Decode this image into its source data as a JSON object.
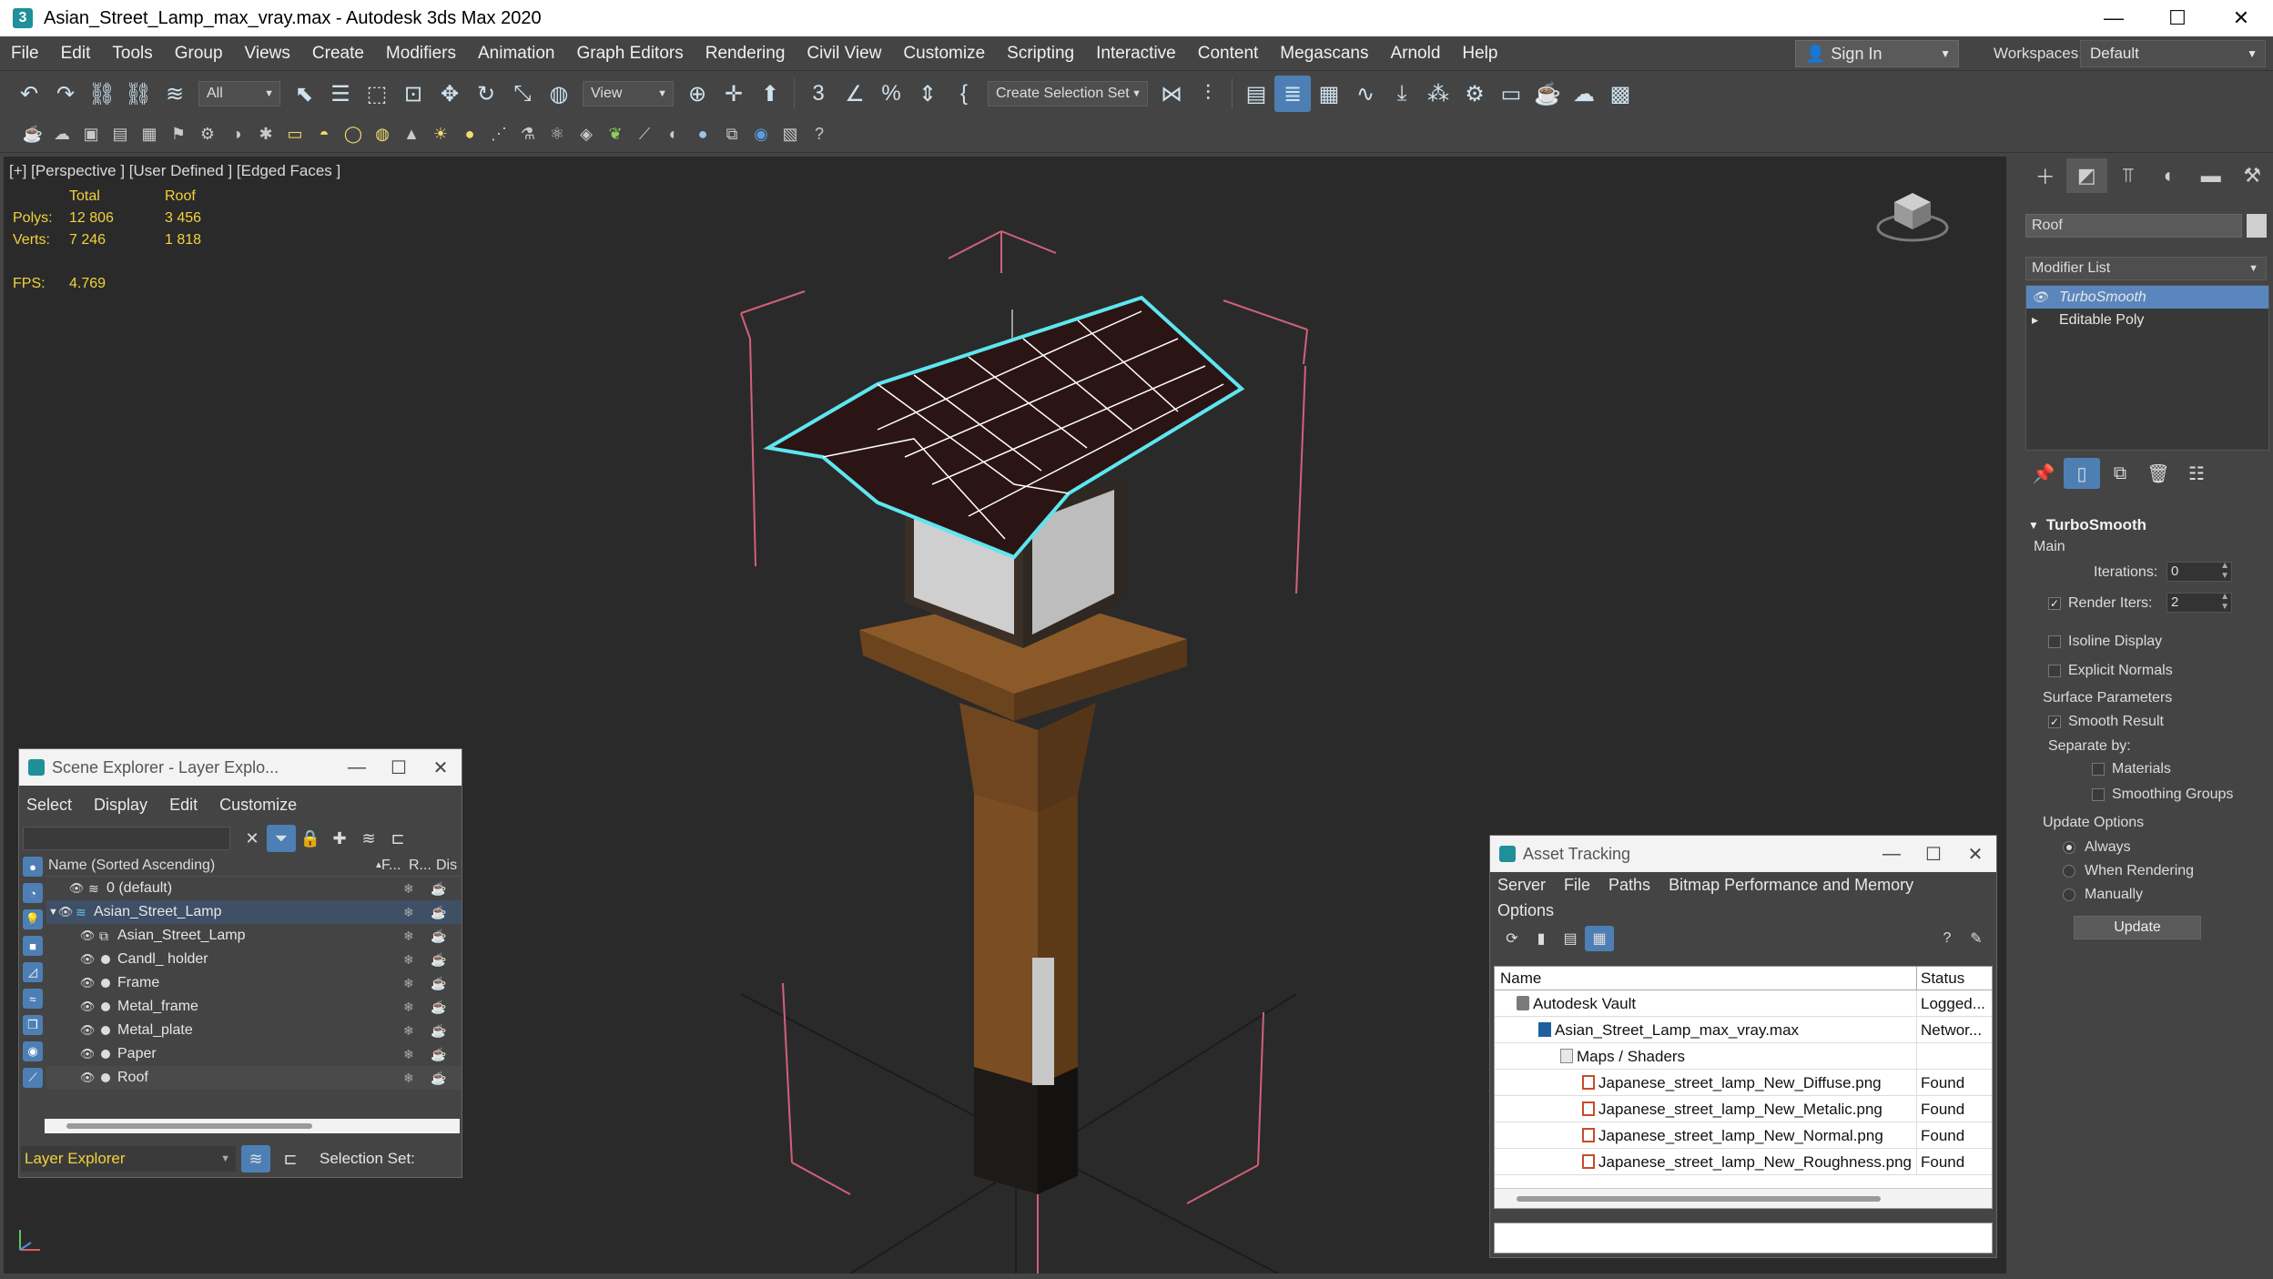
{
  "window": {
    "title": "Asian_Street_Lamp_max_vray.max - Autodesk 3ds Max 2020",
    "app_icon": "3",
    "minimize_icon": "—",
    "maximize_icon": "☐",
    "close_icon": "✕"
  },
  "menubar": {
    "items": [
      "File",
      "Edit",
      "Tools",
      "Group",
      "Views",
      "Create",
      "Modifiers",
      "Animation",
      "Graph Editors",
      "Rendering",
      "Civil View",
      "Customize",
      "Scripting",
      "Interactive",
      "Content",
      "Megascans",
      "Arnold",
      "Help"
    ],
    "signin_label": "Sign In",
    "workspaces_label": "Workspaces:",
    "workspace_value": "Default"
  },
  "toolbar": {
    "selection_filter": "All",
    "reference_coord": "View",
    "named_selection": "Create Selection Set"
  },
  "viewport": {
    "label": "[+] [Perspective ] [User Defined ] [Edged Faces ]",
    "stats": {
      "header": [
        "",
        "Total",
        "Roof"
      ],
      "polys": [
        "Polys:",
        "12 806",
        "3 456"
      ],
      "verts": [
        "Verts:",
        "7 246",
        "1 818"
      ],
      "fps": [
        "FPS:",
        "4.769"
      ]
    }
  },
  "command_panel": {
    "object_name": "Roof",
    "modifier_list_label": "Modifier List",
    "stack": [
      "TurboSmooth",
      "Editable Poly"
    ],
    "rollout": {
      "title": "TurboSmooth",
      "main_label": "Main",
      "iterations_label": "Iterations:",
      "iterations_value": "0",
      "render_iters_label": "Render Iters:",
      "render_iters_value": "2",
      "render_iters_checked": "✓",
      "isoline_label": "Isoline Display",
      "explicit_normals_label": "Explicit Normals",
      "surface_params_label": "Surface Parameters",
      "smooth_result_label": "Smooth Result",
      "smooth_result_checked": "✓",
      "separate_by_label": "Separate by:",
      "materials_label": "Materials",
      "smoothing_groups_label": "Smoothing Groups",
      "update_options_label": "Update Options",
      "always_label": "Always",
      "when_rendering_label": "When Rendering",
      "manually_label": "Manually",
      "update_button": "Update"
    }
  },
  "scene_explorer": {
    "title": "Scene Explorer - Layer Explo...",
    "menu": [
      "Select",
      "Display",
      "Edit",
      "Customize"
    ],
    "columns": [
      "Name (Sorted Ascending)",
      "F...",
      "R...",
      "Dis"
    ],
    "rows": [
      {
        "name": "0 (default)"
      },
      {
        "name": "Asian_Street_Lamp"
      },
      {
        "name": "Asian_Street_Lamp"
      },
      {
        "name": "Candl_ holder"
      },
      {
        "name": "Frame"
      },
      {
        "name": "Metal_frame"
      },
      {
        "name": "Metal_plate"
      },
      {
        "name": "Paper"
      },
      {
        "name": "Roof"
      }
    ],
    "footer_layer": "Layer Explorer",
    "footer_selset": "Selection Set:"
  },
  "asset_tracking": {
    "title": "Asset Tracking",
    "menu_row1": [
      "Server",
      "File",
      "Paths",
      "Bitmap Performance and Memory"
    ],
    "menu_row2": [
      "Options"
    ],
    "columns": [
      "Name",
      "Status"
    ],
    "rows": [
      {
        "name": "Autodesk Vault",
        "status": "Logged..."
      },
      {
        "name": "Asian_Street_Lamp_max_vray.max",
        "status": "Networ..."
      },
      {
        "name": "Maps / Shaders",
        "status": ""
      },
      {
        "name": "Japanese_street_lamp_New_Diffuse.png",
        "status": "Found"
      },
      {
        "name": "Japanese_street_lamp_New_Metalic.png",
        "status": "Found"
      },
      {
        "name": "Japanese_street_lamp_New_Normal.png",
        "status": "Found"
      },
      {
        "name": "Japanese_street_lamp_New_Roughness.png",
        "status": "Found"
      }
    ]
  },
  "colors": {
    "accent": "#4d7fb4",
    "stats_yellow": "#f0d23c",
    "selection_cyan": "#5ee6f0"
  }
}
